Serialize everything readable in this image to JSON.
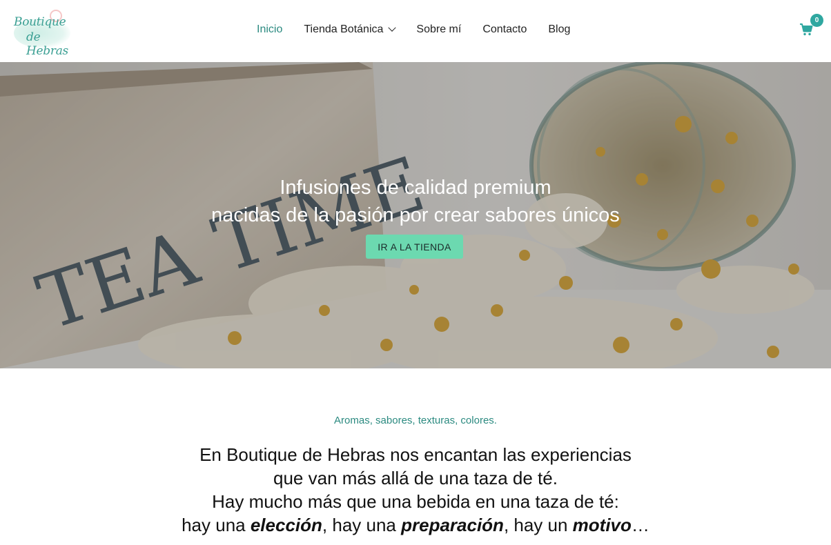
{
  "header": {
    "logo_text_1": "Boutique",
    "logo_text_2": "de Hebras",
    "nav": [
      {
        "label": "Inicio",
        "active": true
      },
      {
        "label": "Tienda Botánica",
        "has_dropdown": true
      },
      {
        "label": "Sobre mí"
      },
      {
        "label": "Contacto"
      },
      {
        "label": "Blog"
      }
    ],
    "cart_count": "0",
    "cart_icon": "shopping-cart-icon"
  },
  "hero": {
    "title_line1": "Infusiones de calidad premium",
    "title_line2": "nacidas de la pasión por crear sabores únicos",
    "cta": "IR A LA TIENDA",
    "box_text": "TEA TIME"
  },
  "intro": {
    "tagline": "Aromas, sabores, texturas, colores.",
    "line1": "En Boutique de Hebras nos encantan las experiencias",
    "line2": "que van más allá de una taza de té.",
    "line3": "Hay mucho más que una bebida en una taza de té:",
    "line4_a": "hay una ",
    "line4_b": "elección",
    "line4_c": ", hay una ",
    "line4_d": "preparación",
    "line4_e": ", hay un ",
    "line4_f": "motivo",
    "line4_g": "…"
  },
  "colors": {
    "accent": "#2b8a80",
    "button": "#6cd9b0",
    "badge": "#2fa7a0"
  }
}
